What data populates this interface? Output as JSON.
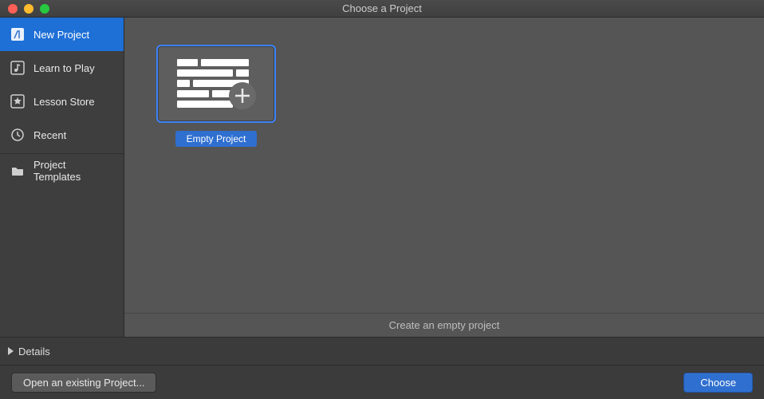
{
  "window": {
    "title": "Choose a Project"
  },
  "sidebar": {
    "items": [
      {
        "label": "New Project",
        "icon": "guitar-icon",
        "selected": true
      },
      {
        "label": "Learn to Play",
        "icon": "note-icon",
        "selected": false
      },
      {
        "label": "Lesson Store",
        "icon": "star-icon",
        "selected": false
      },
      {
        "label": "Recent",
        "icon": "clock-icon",
        "selected": false
      }
    ],
    "secondary": [
      {
        "label": "Project Templates",
        "icon": "folder-icon",
        "selected": false
      }
    ]
  },
  "templates": [
    {
      "label": "Empty Project",
      "selected": true
    }
  ],
  "description": "Create an empty project",
  "details": {
    "label": "Details"
  },
  "buttons": {
    "open_existing": "Open an existing Project...",
    "choose": "Choose"
  }
}
